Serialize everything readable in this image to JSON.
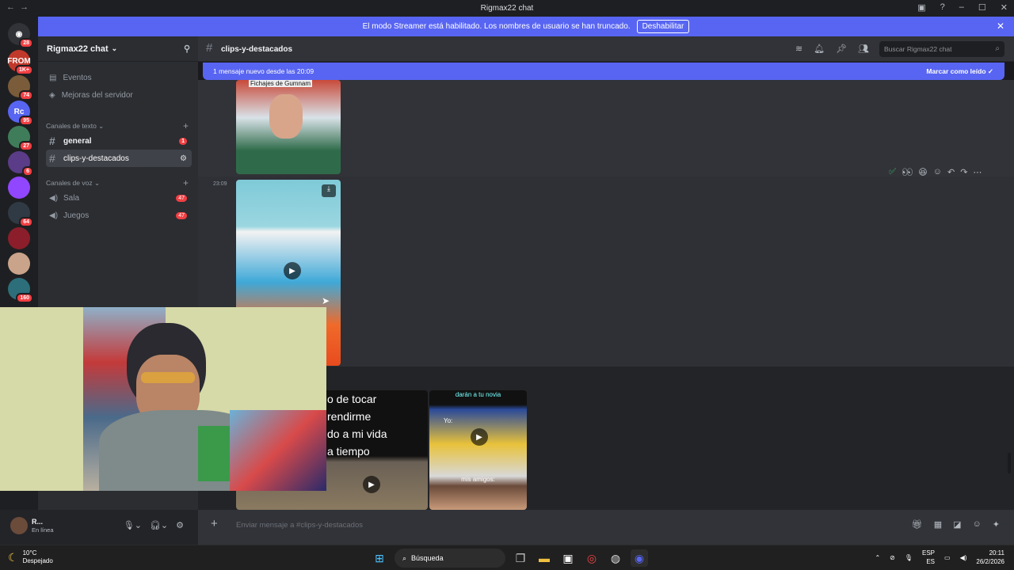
{
  "window": {
    "title": "Rigmax22 chat"
  },
  "banner": {
    "text": "El modo Streamer está habilitado. Los nombres de usuario se han truncado.",
    "button": "Deshabilitar"
  },
  "guilds": [
    {
      "label": "FROM",
      "badge": "1K+",
      "color": "#c0392b"
    },
    {
      "label": "",
      "badge": "74",
      "color": "#7a5c3a"
    },
    {
      "label": "Rc",
      "badge": "95",
      "color": "#5865f2"
    },
    {
      "label": "",
      "badge": "27",
      "color": "#3f7d5a"
    },
    {
      "label": "",
      "badge": "6",
      "color": "#5b3c88"
    },
    {
      "label": "",
      "badge": "",
      "color": "#9146ff"
    },
    {
      "label": "",
      "badge": "64",
      "color": "#2f3a44"
    },
    {
      "label": "",
      "badge": "",
      "color": "#8b1e2a"
    },
    {
      "label": "",
      "badge": "",
      "color": "#c9a38a"
    },
    {
      "label": "",
      "badge": "160",
      "color": "#2c6e7a"
    }
  ],
  "home_badge": "28",
  "server": {
    "name": "Rigmax22 chat"
  },
  "sidebar": {
    "events": "Eventos",
    "boosts": "Mejoras del servidor",
    "text_category": "Canales de texto",
    "text_channels": [
      {
        "name": "general",
        "badge": "1"
      },
      {
        "name": "clips-y-destacados",
        "badge": ""
      }
    ],
    "voice_category": "Canales de voz",
    "voice_channels": [
      {
        "name": "Sala",
        "badge": "47"
      },
      {
        "name": "Juegos",
        "badge": "47"
      }
    ]
  },
  "channel": {
    "name": "clips-y-destacados",
    "search_placeholder": "Buscar Rigmax22 chat"
  },
  "new_messages": {
    "text": "1 mensaje nuevo desde las 20:09",
    "mark_read": "Marcar como leído"
  },
  "messages": {
    "timestamp": "23:09",
    "top_caption": "Fichajes de Gumnam",
    "lower_text_lines": [
      "o de tocar",
      "rendirme",
      "do a mi vida",
      "a tiempo"
    ],
    "right_caption_top": "darán a tu novia",
    "right_caption_yo": "Yo:",
    "right_caption_bottom": "mis amigos:"
  },
  "composer": {
    "placeholder": "Enviar mensaje a #clips-y-destacados"
  },
  "user": {
    "name": "R...",
    "status": "En línea"
  },
  "taskbar": {
    "temp": "10°C",
    "weather": "Despejado",
    "search": "Búsqueda",
    "lang1": "ESP",
    "lang2": "ES",
    "time": "20:11",
    "date": "26/2/2026"
  }
}
